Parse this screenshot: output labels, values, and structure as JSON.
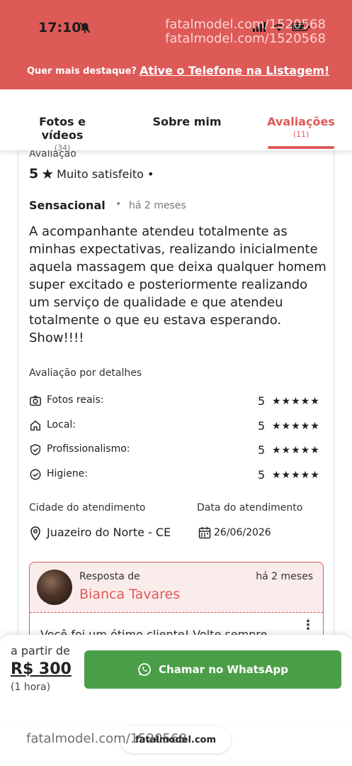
{
  "status_bar": {
    "time": "17:10",
    "watermark": "fatalmodel.com/1520568"
  },
  "promo": {
    "question": "Quer mais destaque?",
    "link": "Ative o Telefone na Listagem!"
  },
  "tabs": [
    {
      "label": "Fotos e vídeos",
      "count": "(34)"
    },
    {
      "label": "Sobre mim",
      "count": ""
    },
    {
      "label": "Avaliações",
      "count": "(11)"
    }
  ],
  "review": {
    "rating_label": "Avaliação",
    "rating_value": "5",
    "rating_star": "★",
    "rating_text": "Muito satisfeito •",
    "title": "Sensacional",
    "separator": "•",
    "time": "há 2 meses",
    "body": "A acompanhante atendeu totalmente as minhas expectativas, realizando inicialmente aquela massagem que deixa qualquer homem super excitado e posteriormente realizando um serviço de qualidade e que atendeu totalmente o que eu estava esperando. Show!!!!",
    "details_title": "Avaliação por detalhes",
    "details": [
      {
        "icon": "camera-check-icon",
        "label": "Fotos reais:",
        "score": "5",
        "stars": "★★★★★"
      },
      {
        "icon": "home-icon",
        "label": "Local:",
        "score": "5",
        "stars": "★★★★★"
      },
      {
        "icon": "shield-check-icon",
        "label": "Profissionalismo:",
        "score": "5",
        "stars": "★★★★★"
      },
      {
        "icon": "check-circle-icon",
        "label": "Higiene:",
        "score": "5",
        "stars": "★★★★★"
      }
    ],
    "city_label": "Cidade do atendimento",
    "city": "Juazeiro do Norte - CE",
    "date_label": "Data do atendimento",
    "date": "26/06/2026"
  },
  "reply": {
    "from_label": "Resposta de",
    "name": "Bianca Tavares",
    "time": "há 2 meses",
    "text": "Você foi um ótimo cliente! Volte sempre",
    "menu": "⋮"
  },
  "bottom": {
    "price_from": "a partir de",
    "price": "R$ 300",
    "price_unit": "(1 hora)",
    "whatsapp_label": "Chamar no WhatsApp"
  },
  "browser": {
    "url": "fatalmodel.com",
    "watermark": "fatalmodel.com/1520568"
  },
  "colors": {
    "brand": "#de5a57",
    "whatsapp": "#4b9e48"
  }
}
